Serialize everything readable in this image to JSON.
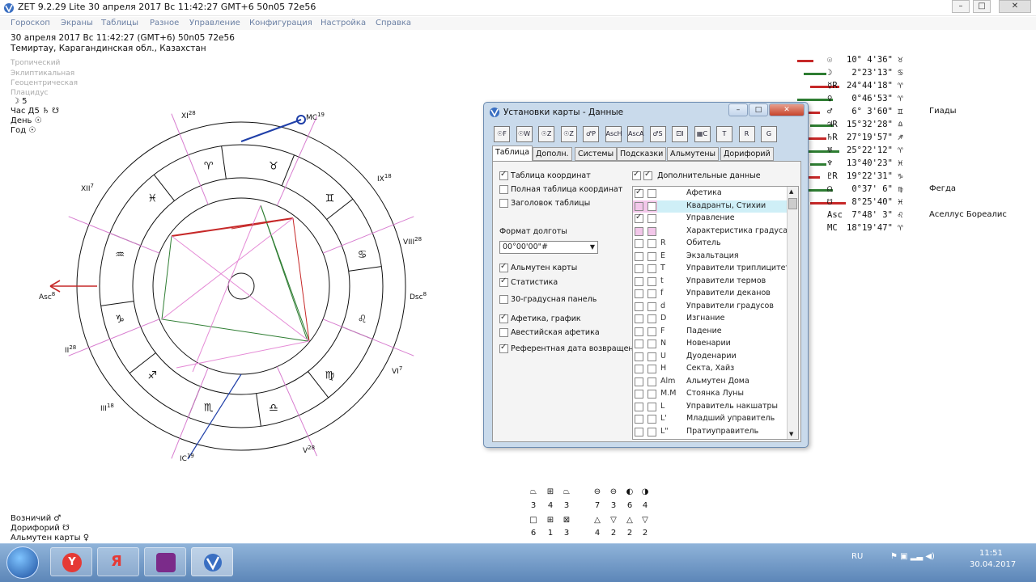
{
  "window": {
    "title": "ZET 9.2.29 Lite   30 апреля 2017  Вс  11:42:27 GMT+6 50n05  72e56",
    "min": "–",
    "max": "□",
    "close": "✕"
  },
  "menu": [
    "Гороскоп",
    "Экраны",
    "Таблицы",
    "Разное",
    "Управление",
    "Конфигурация",
    "Настройка",
    "Справка"
  ],
  "header": {
    "line1": "30 апреля 2017  Вс  11:42:27 (GMT+6) 50n05  72e56",
    "line2": "Темиртау, Карагандинская обл., Казахстан"
  },
  "settings_info": [
    "Тропический",
    "Эклиптикальная",
    "Геоцентрическая",
    "Плацидус"
  ],
  "time_info": {
    "moon": "☽  5",
    "hour": "Час Д5  ♄ ☋",
    "day": "День  ☉",
    "year": "Год  ☉"
  },
  "house_labels": {
    "mc": "MC",
    "mc_n": "19",
    "ic": "IC",
    "ic_n": "19",
    "asc": "Asc",
    "asc_n": "8",
    "dsc": "Dsc",
    "dsc_n": "8",
    "xi": "XI",
    "xi_n": "28",
    "xii": "XII",
    "xii_n": "7",
    "ix": "IX",
    "ix_n": "18",
    "viii": "VIII",
    "viii_n": "28",
    "ii": "II",
    "ii_n": "28",
    "iii": "III",
    "iii_n": "18",
    "v": "V",
    "v_n": "28",
    "vi": "VI",
    "vi_n": "7"
  },
  "zodiac_glyphs": [
    "♉",
    "♊",
    "♋",
    "♌",
    "♍",
    "♎",
    "♏",
    "♐",
    "♑",
    "♒",
    "♓",
    "♈"
  ],
  "planets": [
    {
      "glyph": "☉",
      "pos": "10° 4'36\"",
      "sign": "♉",
      "note": ""
    },
    {
      "glyph": "☽",
      "pos": " 2°23'13\"",
      "sign": "♋",
      "note": ""
    },
    {
      "glyph": "☿R",
      "pos": "24°44'18\"",
      "sign": "♈",
      "note": ""
    },
    {
      "glyph": "♀",
      "pos": " 0°46'53\"",
      "sign": "♈",
      "note": ""
    },
    {
      "glyph": "♂",
      "pos": " 6° 3'60\"",
      "sign": "♊",
      "note": "Гиады"
    },
    {
      "glyph": "♃R",
      "pos": "15°32'28\"",
      "sign": "♎",
      "note": ""
    },
    {
      "glyph": "♄R",
      "pos": "27°19'57\"",
      "sign": "♐",
      "note": ""
    },
    {
      "glyph": "♅",
      "pos": "25°22'12\"",
      "sign": "♈",
      "note": ""
    },
    {
      "glyph": "♆",
      "pos": "13°40'23\"",
      "sign": "♓",
      "note": ""
    },
    {
      "glyph": "♇R",
      "pos": "19°22'31\"",
      "sign": "♑",
      "note": ""
    },
    {
      "glyph": "☊",
      "pos": " 0°37' 6\"",
      "sign": "♍",
      "note": "Фегда"
    },
    {
      "glyph": "☋",
      "pos": " 8°25'40\"",
      "sign": "♓",
      "note": ""
    },
    {
      "glyph": "Asc",
      "pos": " 7°48' 3\"",
      "sign": "♌",
      "note": "Аселлус Бореалис"
    },
    {
      "glyph": "MC",
      "pos": "18°19'47\"",
      "sign": "♈",
      "note": ""
    }
  ],
  "bottom_left": [
    "Возничий  ♂",
    "Дорифорий  ☋",
    "Альмутен карты  ♀"
  ],
  "aspect_counts": {
    "top_icons": [
      "⏢",
      "⊞",
      "⏢",
      "⊖",
      "⊖",
      "◐",
      "◑"
    ],
    "top_nums": [
      "3",
      "4",
      "3",
      "7",
      "3",
      "6",
      "4"
    ],
    "bot_icons": [
      "□",
      "⊞",
      "⊠",
      "△",
      "▽",
      "△",
      "▽"
    ],
    "bot_nums": [
      "6",
      "1",
      "3",
      "4",
      "2",
      "2",
      "2"
    ]
  },
  "dialog": {
    "title": "Установки карты - Данные",
    "toolbar": [
      "☉F",
      "☉W",
      "☉Z",
      "☉Z",
      "♂P",
      "AscH",
      "AscA",
      "♂S",
      "⚀I",
      "▦C",
      "T",
      "R",
      "G"
    ],
    "tabs": [
      "Таблица",
      "Дополн.",
      "Системы",
      "Подсказки",
      "Альмутены",
      "Дорифорий"
    ],
    "options": [
      {
        "label": "Таблица координат",
        "checked": true
      },
      {
        "label": "Полная таблица координат",
        "checked": false
      },
      {
        "label": "Заголовок таблицы",
        "checked": false
      }
    ],
    "format_label": "Формат долготы",
    "format_value": "00°00'00\"#",
    "options2": [
      {
        "label": "Альмутен карты",
        "checked": true
      },
      {
        "label": "Статистика",
        "checked": true
      },
      {
        "label": "30-градусная панель",
        "checked": false
      },
      {
        "label": "Афетика, график",
        "checked": true
      },
      {
        "label": "Авестийская афетика",
        "checked": false
      },
      {
        "label": "Референтная дата возвращения в заголовке",
        "checked": true
      }
    ],
    "extra_label": "Дополнительные данные",
    "list": [
      {
        "ab": "",
        "nm": "Афетика",
        "c1": true,
        "c2": false,
        "hl": ""
      },
      {
        "ab": "",
        "nm": "Квадранты, Стихии",
        "c1": false,
        "c2": false,
        "hl": "pink"
      },
      {
        "ab": "",
        "nm": "Управление",
        "c1": true,
        "c2": false,
        "hl": ""
      },
      {
        "ab": "",
        "nm": "Характеристика градуса",
        "c1": false,
        "c2": false,
        "hl": "pink2"
      },
      {
        "ab": "R",
        "nm": "Обитель",
        "c1": false,
        "c2": false,
        "hl": ""
      },
      {
        "ab": "E",
        "nm": "Экзальтация",
        "c1": false,
        "c2": false,
        "hl": ""
      },
      {
        "ab": "T",
        "nm": "Управители триплицитета",
        "c1": false,
        "c2": false,
        "hl": ""
      },
      {
        "ab": "t",
        "nm": "Управители термов",
        "c1": false,
        "c2": false,
        "hl": ""
      },
      {
        "ab": "f",
        "nm": "Управители деканов",
        "c1": false,
        "c2": false,
        "hl": ""
      },
      {
        "ab": "d",
        "nm": "Управители градусов",
        "c1": false,
        "c2": false,
        "hl": ""
      },
      {
        "ab": "D",
        "nm": "Изгнание",
        "c1": false,
        "c2": false,
        "hl": ""
      },
      {
        "ab": "F",
        "nm": "Падение",
        "c1": false,
        "c2": false,
        "hl": ""
      },
      {
        "ab": "N",
        "nm": "Новенарии",
        "c1": false,
        "c2": false,
        "hl": ""
      },
      {
        "ab": "U",
        "nm": "Дуоденарии",
        "c1": false,
        "c2": false,
        "hl": ""
      },
      {
        "ab": "H",
        "nm": "Секта, Хайз",
        "c1": false,
        "c2": false,
        "hl": ""
      },
      {
        "ab": "Alm",
        "nm": "Альмутен Дома",
        "c1": false,
        "c2": false,
        "hl": ""
      },
      {
        "ab": "M.M",
        "nm": "Стоянка Луны",
        "c1": false,
        "c2": false,
        "hl": ""
      },
      {
        "ab": "L",
        "nm": "Управитель накшатры",
        "c1": false,
        "c2": false,
        "hl": ""
      },
      {
        "ab": "L'",
        "nm": "Младший управитель",
        "c1": false,
        "c2": false,
        "hl": ""
      },
      {
        "ab": "L\"",
        "nm": "Пратиуправитель",
        "c1": false,
        "c2": false,
        "hl": ""
      }
    ]
  },
  "tray": {
    "lang": "RU",
    "time": "11:51",
    "date": "30.04.2017"
  },
  "colors": {
    "accent": "#1f3fa8",
    "red": "#c62828",
    "green": "#2e7d32",
    "pink": "#e58bd6"
  }
}
